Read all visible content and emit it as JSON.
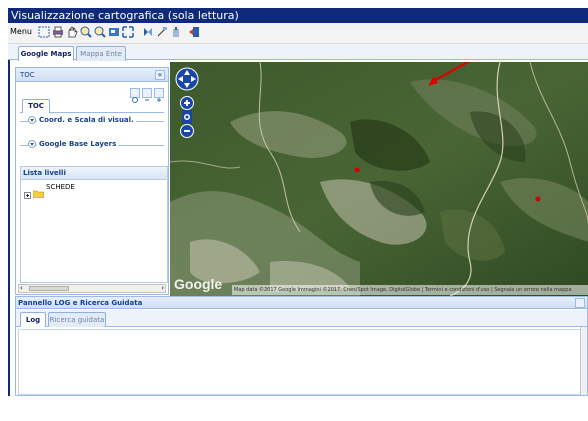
{
  "window": {
    "title": "Visualizzazione cartografica (sola lettura)"
  },
  "toolbar": {
    "menu_label": "Menu",
    "icons": [
      "select-icon",
      "print-icon",
      "pan-icon",
      "zoom-in-icon",
      "zoom-out-icon",
      "zoom-box-icon",
      "full-extent-icon",
      "info-icon",
      "measure-icon",
      "identify-icon",
      "exit-icon"
    ]
  },
  "tabs": [
    {
      "label": "Google Maps",
      "active": true
    },
    {
      "label": "Mappa Ente",
      "active": false
    }
  ],
  "toc": {
    "title": "TOC",
    "collapse_symbol": "«",
    "inner_tab": "TOC",
    "fieldsets": [
      {
        "label": "Coord. e Scala di visual."
      },
      {
        "label": "Google Base Layers"
      }
    ],
    "layer_list_title": "Lista livelli",
    "layers": [
      {
        "label": "SCHEDE"
      }
    ]
  },
  "map": {
    "logo": "Google",
    "attribution": "Map data ©2017 Google Immagini ©2017, Cnes/Spot Image, DigitalGlobe | Termini e condizioni d'uso | Segnala un errore nella mappa",
    "colors": {
      "red_marker": "#d40000",
      "arrow": "#e00000"
    }
  },
  "log_panel": {
    "title": "Pannello LOG e Ricerca Guidata",
    "tabs": [
      {
        "label": "Log",
        "active": true
      },
      {
        "label": "Ricerca guidata",
        "active": false
      }
    ]
  }
}
